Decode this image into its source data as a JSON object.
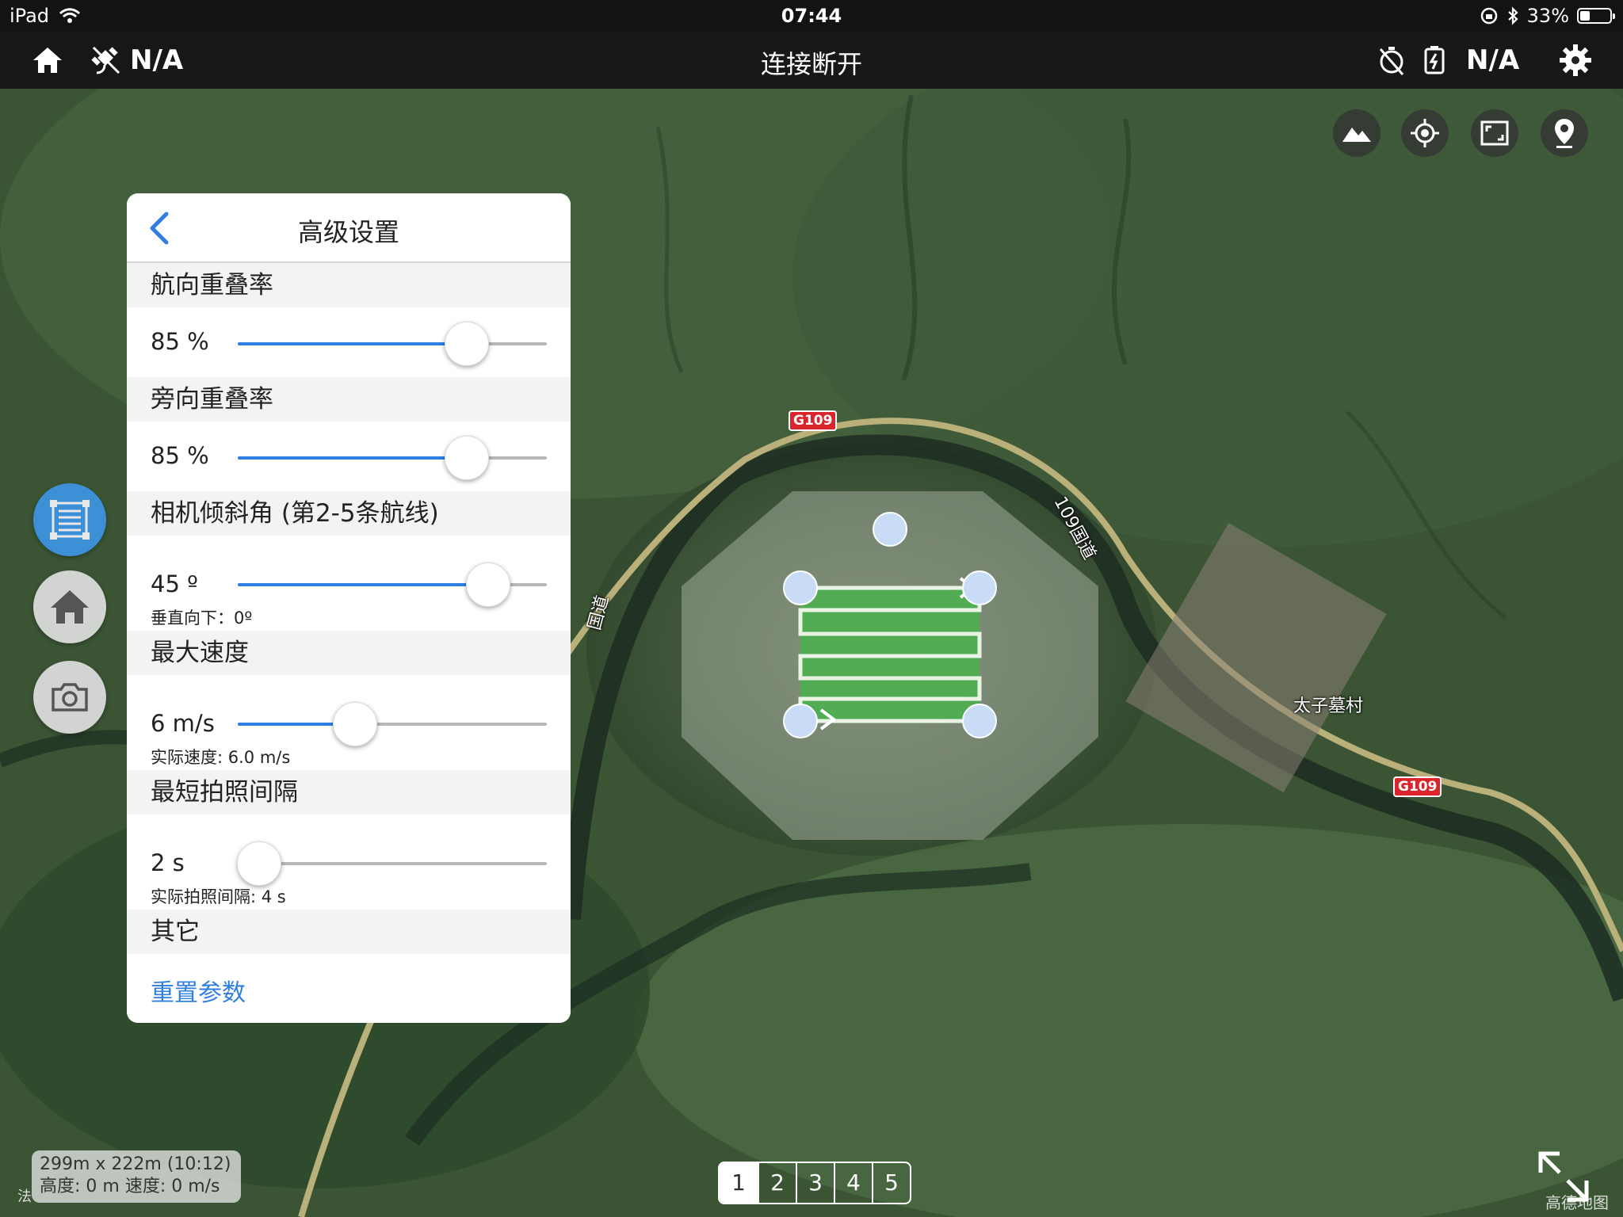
{
  "status_bar": {
    "device": "iPad",
    "time": "07:44",
    "battery": "33%",
    "battery_level": 0.33
  },
  "nav": {
    "title": "连接断开",
    "left_status": "N/A",
    "right_status": "N/A"
  },
  "panel": {
    "title": "高级设置",
    "forward_overlap": {
      "label": "航向重叠率",
      "value": "85 %",
      "fraction": 0.74
    },
    "side_overlap": {
      "label": "旁向重叠率",
      "value": "85 %",
      "fraction": 0.74
    },
    "camera_tilt": {
      "label": "相机倾斜角 (第2-5条航线)",
      "value": "45 º",
      "fraction": 0.81,
      "note": "垂直向下：0º"
    },
    "max_speed": {
      "label": "最大速度",
      "value": "6 m/s",
      "fraction": 0.38,
      "note": "实际速度: 6.0 m/s"
    },
    "min_interval": {
      "label": "最短拍照间隔",
      "value": "2 s",
      "fraction": 0.07,
      "note": "实际拍照间隔: 4 s"
    },
    "other": {
      "label": "其它",
      "reset": "重置参数"
    }
  },
  "info": {
    "dimensions": "299m x 222m (10:12)",
    "altitude_speed": "高度: 0 m  速度: 0 m/s",
    "side_text": "法"
  },
  "pager": {
    "pages": [
      "1",
      "2",
      "3",
      "4",
      "5"
    ],
    "active": "1"
  },
  "map": {
    "road_badge_1": "G109",
    "road_badge_2": "G109",
    "road_label_1": "109国道",
    "road_label_2": "国道",
    "village_label": "太子墓村",
    "watermark": "高德地图"
  },
  "colors": {
    "accent": "#2f7fe0",
    "active_tool": "#3d8fd6",
    "survey_area": "#4caf50"
  }
}
